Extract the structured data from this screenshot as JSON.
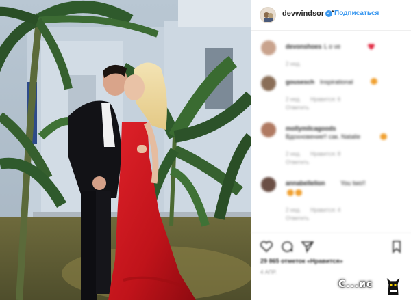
{
  "header": {
    "username": "devwindsor",
    "verified_mark": "✓",
    "separator": "•",
    "follow_label": "Подписаться"
  },
  "comments": [
    {
      "user": "devonshoes",
      "text": "L o ve",
      "time": "2 нед.",
      "reply": "",
      "avatar_color": "#c9a38d",
      "emoji": "heart"
    },
    {
      "user": "gousesch",
      "text": "Inspirational",
      "time": "2 нед.",
      "reply": "Ответить",
      "likes": "Нравится: 6",
      "avatar_color": "#8a6e57",
      "emoji": "smile"
    },
    {
      "user": "mollymilcagoods",
      "text": "Вдохновение!! сак. Natalie",
      "time": "2 нед.",
      "reply": "Ответить",
      "likes": "Нравится: 8",
      "avatar_color": "#b07a62",
      "emoji": "smile"
    },
    {
      "user": "annabellelion",
      "text": "You two!!",
      "time": "2 нед.",
      "reply": "Ответить",
      "likes": "Нравится: 4",
      "avatar_color": "#6b4f45",
      "emoji": "smile"
    }
  ],
  "actions": {
    "like_icon": "heart-outline-icon",
    "comment_icon": "speech-bubble-icon",
    "share_icon": "paper-plane-icon",
    "save_icon": "bookmark-icon"
  },
  "likes_text": "29 865 отметок «Нравится»",
  "date_text": "4 АПР.",
  "watermark": {
    "text": "С...ис",
    "icon": "black-cat-icon"
  },
  "colors": {
    "accent": "#3897f0",
    "dress": "#c8151b",
    "suit": "#101014",
    "foliage": "#2f5a2c"
  }
}
